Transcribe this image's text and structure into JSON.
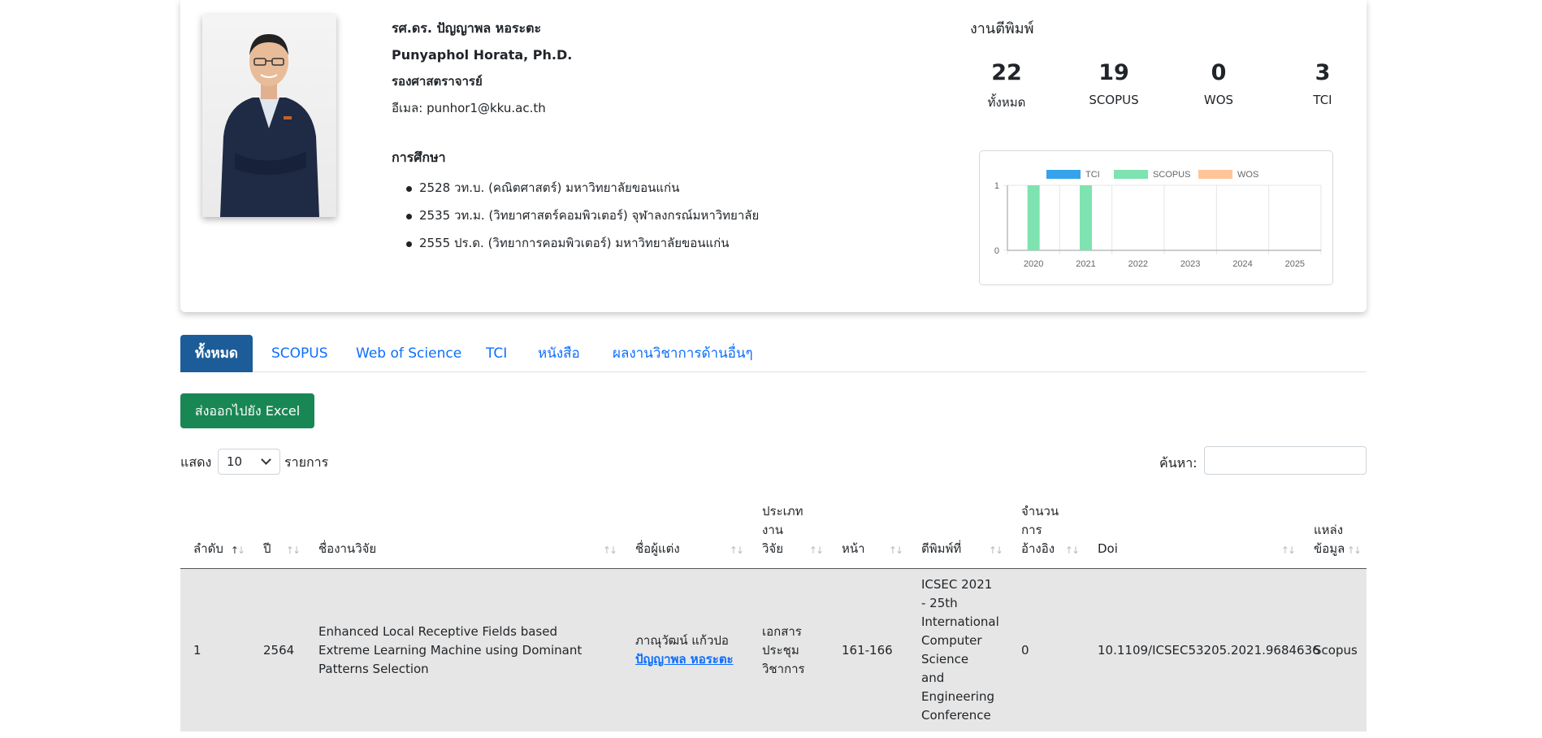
{
  "profile": {
    "name_th": "รศ.ดร. ปัญญาพล หอระตะ",
    "name_en": "Punyaphol Horata, Ph.D.",
    "position": "รองศาสตราจารย์",
    "email_label": "อีเมล:",
    "email": "punhor1@kku.ac.th",
    "education_title": "การศึกษา",
    "education": [
      "2528 วท.บ. (คณิตศาสตร์) มหาวิทยาลัยขอนแก่น",
      "2535 วท.ม. (วิทยาศาสตร์คอมพิวเตอร์) จุฬาลงกรณ์มหาวิทยาลัย",
      "2555 ปร.ด. (วิทยาการคอมพิวเตอร์) มหาวิทยาลัยขอนแก่น"
    ]
  },
  "publications": {
    "title": "งานตีพิมพ์",
    "stats": [
      {
        "value": "22",
        "label": "ทั้งหมด"
      },
      {
        "value": "19",
        "label": "SCOPUS"
      },
      {
        "value": "0",
        "label": "WOS"
      },
      {
        "value": "3",
        "label": "TCI"
      }
    ]
  },
  "chart_data": {
    "type": "bar",
    "categories": [
      "2020",
      "2021",
      "2022",
      "2023",
      "2024",
      "2025"
    ],
    "series": [
      {
        "name": "TCI",
        "color": "#36a2eb",
        "values": [
          0,
          0,
          0,
          0,
          0,
          0
        ]
      },
      {
        "name": "SCOPUS",
        "color": "#7ee3b0",
        "values": [
          1,
          1,
          0,
          0,
          0,
          0
        ]
      },
      {
        "name": "WOS",
        "color": "#ffc599",
        "values": [
          0,
          0,
          0,
          0,
          0,
          0
        ]
      }
    ],
    "yticks": [
      "0",
      "1"
    ],
    "ylim": [
      0,
      1
    ],
    "legend": "top",
    "grid": true
  },
  "tabs": [
    "ทั้งหมด",
    "SCOPUS",
    "Web of Science",
    "TCI",
    "หนังสือ",
    "ผลงานวิชาการด้านอื่นๆ"
  ],
  "export_label": "ส่งออกไปยัง Excel",
  "length": {
    "show_label": "แสดง",
    "value": "10",
    "unit_label": "รายการ"
  },
  "search": {
    "label": "ค้นหา:",
    "value": ""
  },
  "table": {
    "headers": [
      {
        "lines": [
          "ลำดับ"
        ]
      },
      {
        "lines": [
          "ปี"
        ]
      },
      {
        "lines": [
          "ชื่องานวิจัย"
        ]
      },
      {
        "lines": [
          "ชื่อผู้แต่ง"
        ]
      },
      {
        "lines": [
          "ประเภท",
          "งาน",
          "วิจัย"
        ]
      },
      {
        "lines": [
          "หน้า"
        ]
      },
      {
        "lines": [
          "ตีพิมพ์ที่"
        ]
      },
      {
        "lines": [
          "จำนวน",
          "การ",
          "อ้างอิง"
        ]
      },
      {
        "lines": [
          "Doi"
        ]
      },
      {
        "lines": [
          "แหล่ง",
          "ข้อมูล"
        ]
      }
    ],
    "rows": [
      {
        "no": "1",
        "year": "2564",
        "title": "Enhanced Local Receptive Fields based Extreme Learning Machine using Dominant Patterns Selection",
        "author1": "ภาณุวัฒน์ แก้วปอ",
        "author2": "ปัญญาพล หอระตะ",
        "type": "เอกสาร ประชุม วิชาการ",
        "pages": "161-166",
        "venue": "ICSEC 2021 - 25th International Computer Science and Engineering Conference",
        "citations": "0",
        "doi": "10.1109/ICSEC53205.2021.9684636",
        "source": "Scopus"
      }
    ]
  }
}
